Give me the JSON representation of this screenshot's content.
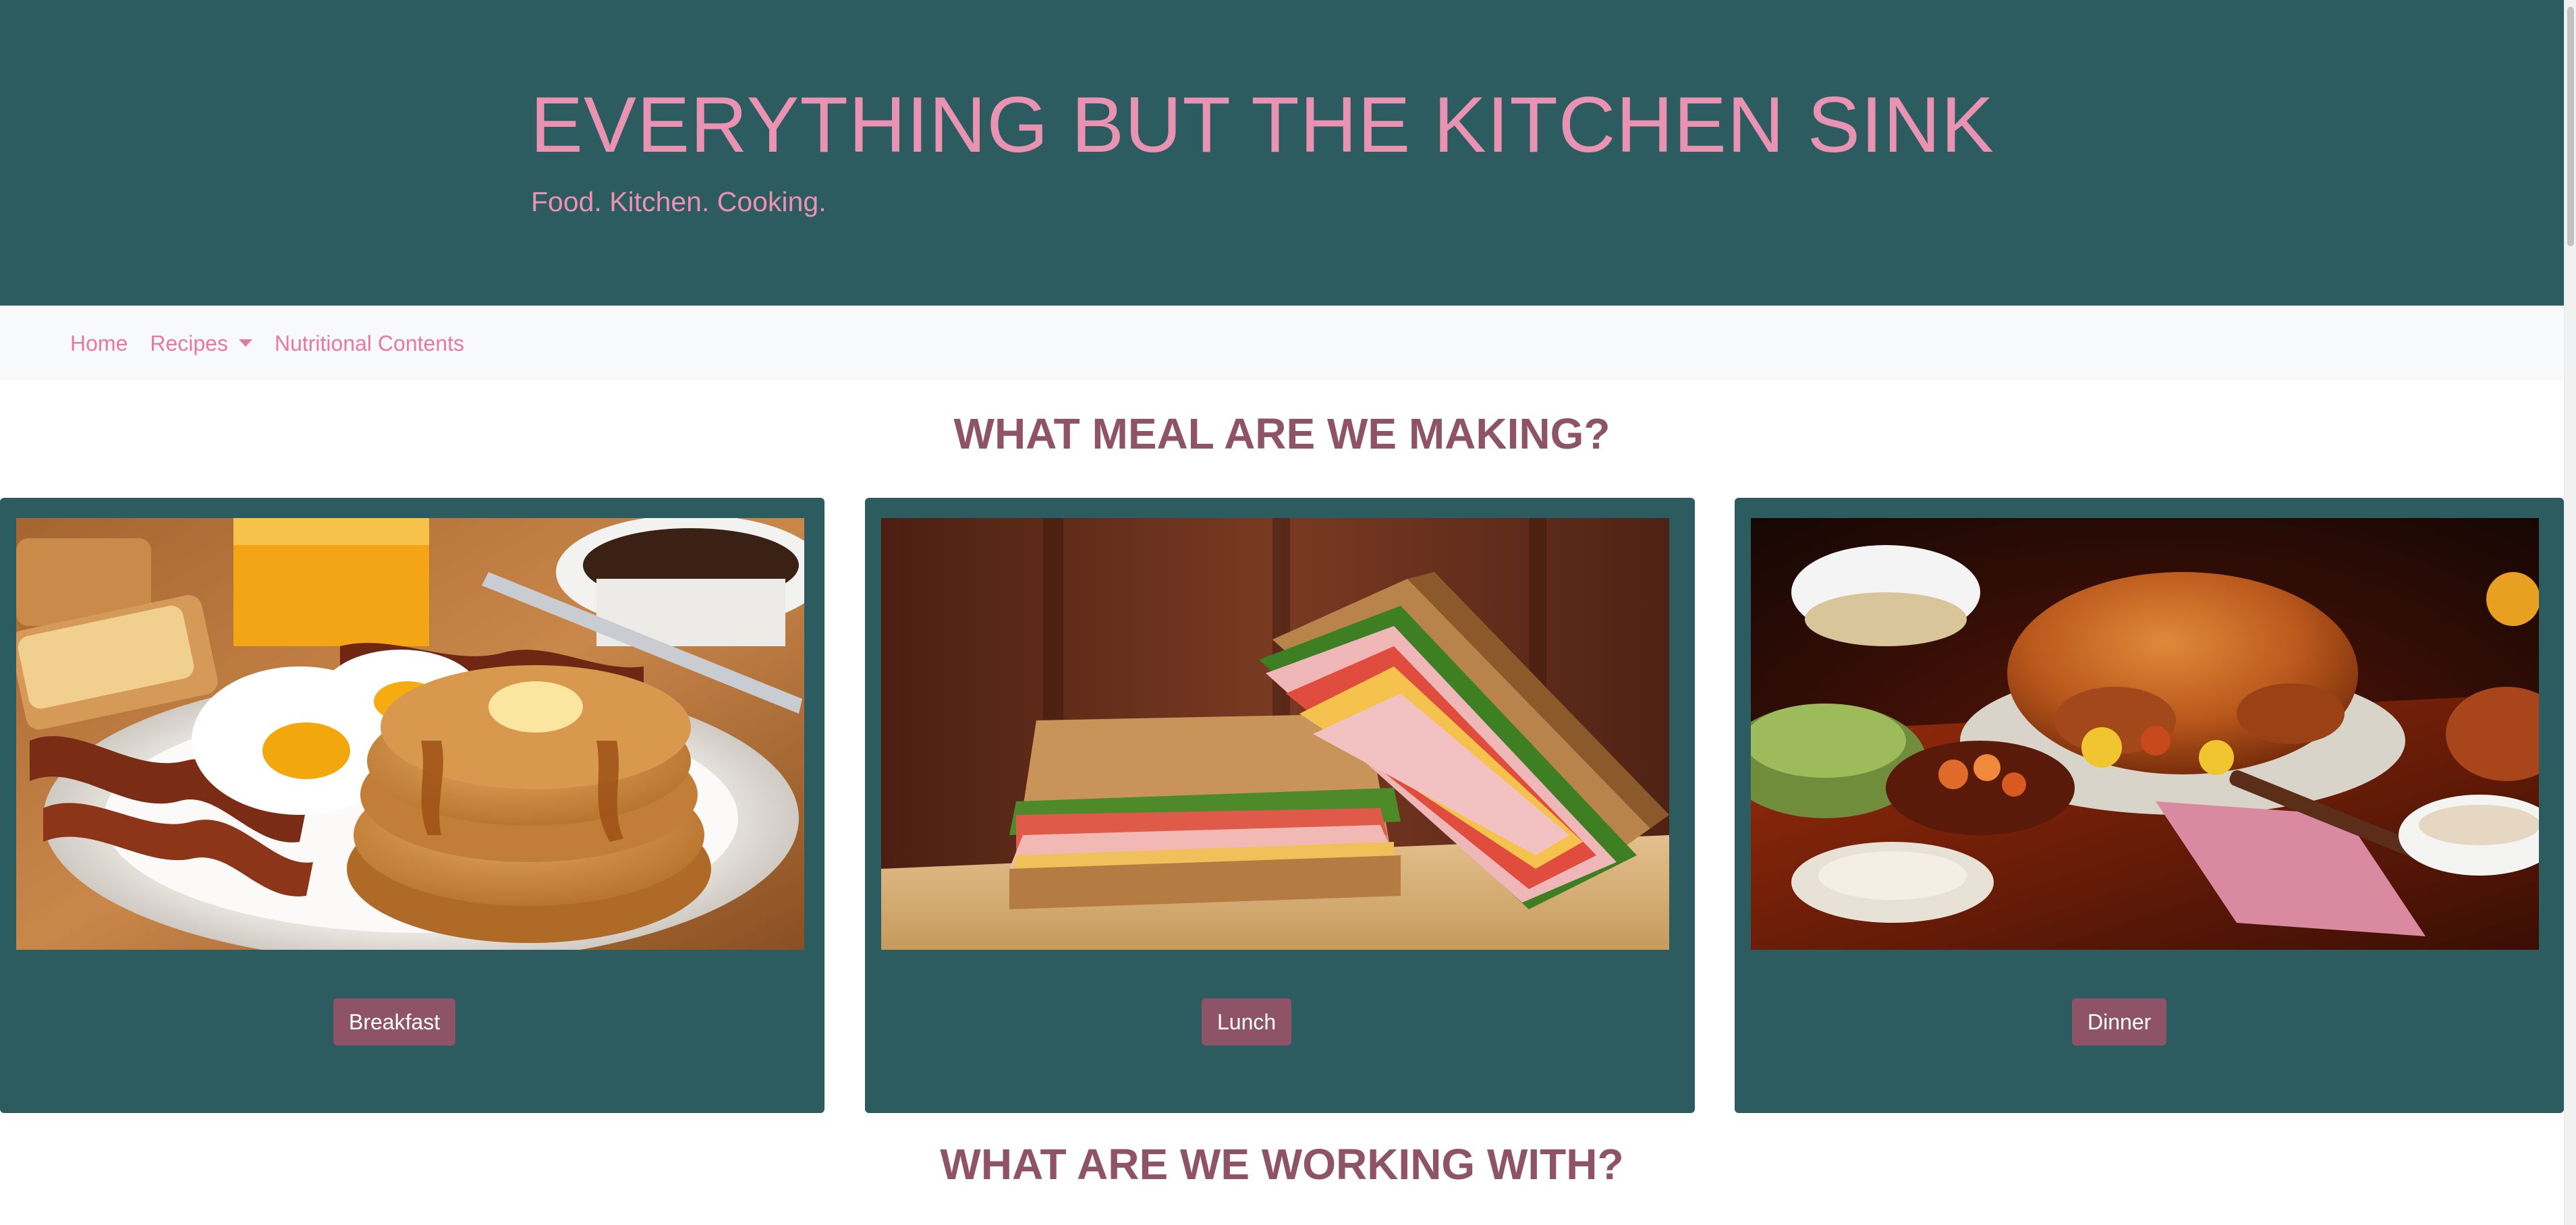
{
  "header": {
    "title": "EVERYTHING BUT THE KITCHEN SINK",
    "tagline": "Food. Kitchen. Cooking."
  },
  "nav": {
    "items": [
      {
        "label": "Home"
      },
      {
        "label": "Recipes",
        "icon": "caret-down-icon"
      },
      {
        "label": "Nutritional Contents"
      }
    ]
  },
  "sections": {
    "meals_heading": "WHAT MEAL ARE WE MAKING?",
    "working_heading": "WHAT ARE WE WORKING WITH?"
  },
  "cards": [
    {
      "button_label": "Breakfast",
      "image": "breakfast-photo"
    },
    {
      "button_label": "Lunch",
      "image": "sandwich-photo"
    },
    {
      "button_label": "Dinner",
      "image": "roast-turkey-dinner-photo"
    }
  ],
  "colors": {
    "header_bg": "#2c5b60",
    "title_pink": "#ea92b2",
    "nav_link": "#e8799e",
    "heading_mauve": "#8f5368",
    "button_bg": "#8f5368",
    "navbar_bg": "#f8f9fa"
  }
}
